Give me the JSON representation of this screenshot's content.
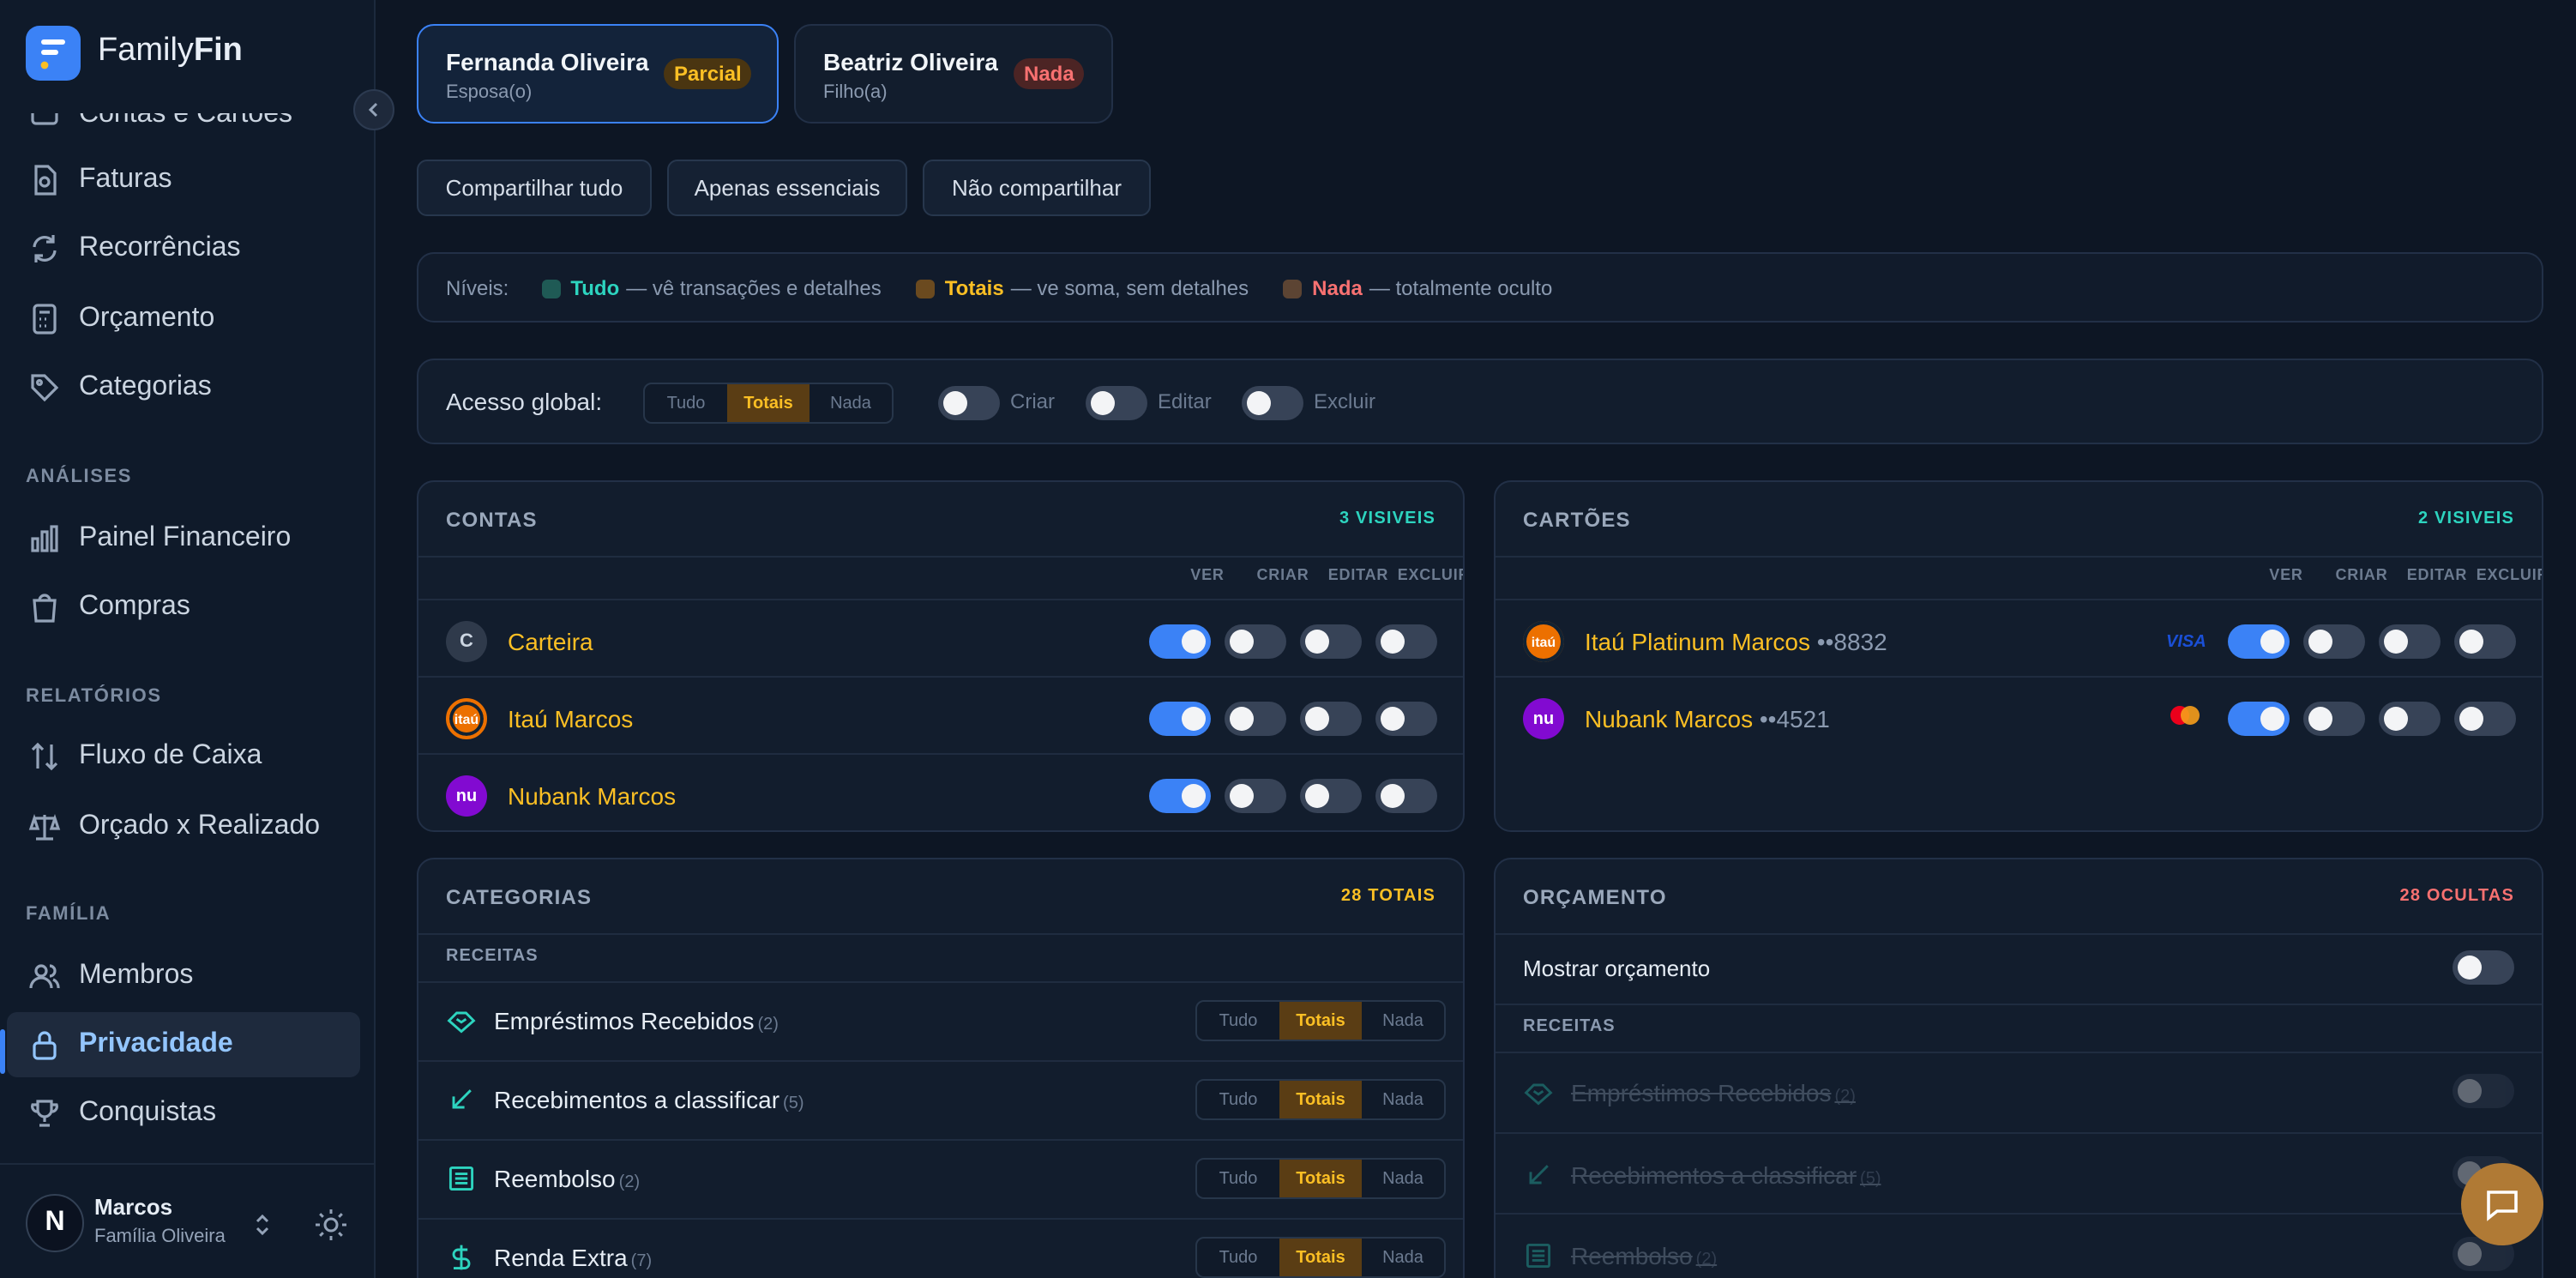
{
  "app": {
    "brand_prefix": "Family",
    "brand_suffix": "Fin"
  },
  "sidebar": {
    "partial_top_item": "Contas e Cartões",
    "items": [
      {
        "label": "Faturas",
        "icon": "invoice-icon"
      },
      {
        "label": "Recorrências",
        "icon": "refresh-icon"
      },
      {
        "label": "Orçamento",
        "icon": "calculator-icon"
      },
      {
        "label": "Categorias",
        "icon": "tag-icon"
      }
    ],
    "analises_title": "ANÁLISES",
    "analises": [
      {
        "label": "Painel Financeiro",
        "icon": "bar-chart-icon"
      },
      {
        "label": "Compras",
        "icon": "shopping-bag-icon"
      }
    ],
    "relatorios_title": "RELATÓRIOS",
    "relatorios": [
      {
        "label": "Fluxo de Caixa",
        "icon": "arrows-updown-icon"
      },
      {
        "label": "Orçado x Realizado",
        "icon": "scale-icon"
      }
    ],
    "familia_title": "FAMÍLIA",
    "familia": [
      {
        "label": "Membros",
        "icon": "users-icon"
      },
      {
        "label": "Privacidade",
        "icon": "lock-icon",
        "active": true
      },
      {
        "label": "Conquistas",
        "icon": "trophy-icon"
      }
    ],
    "user": {
      "initial": "N",
      "name": "Marcos",
      "family": "Família Oliveira"
    }
  },
  "members": [
    {
      "name": "Fernanda Oliveira",
      "role": "Esposa(o)",
      "badge": "Parcial",
      "selected": true
    },
    {
      "name": "Beatriz Oliveira",
      "role": "Filho(a)",
      "badge": "Nada",
      "selected": false
    }
  ],
  "presets": [
    "Compartilhar tudo",
    "Apenas essenciais",
    "Não compartilhar"
  ],
  "levels": {
    "label": "Níveis:",
    "tudo": "Tudo",
    "tudo_desc": "— vê transações e detalhes",
    "totais": "Totais",
    "totais_desc": "— ve soma, sem detalhes",
    "nada": "Nada",
    "nada_desc": "— totalmente oculto"
  },
  "global": {
    "label": "Acesso global:",
    "options": [
      "Tudo",
      "Totais",
      "Nada"
    ],
    "selected": "Totais",
    "criar": "Criar",
    "editar": "Editar",
    "excluir": "Excluir"
  },
  "columns": {
    "ver": "VER",
    "criar": "CRIAR",
    "editar": "EDITAR",
    "excluir": "EXCLUIR"
  },
  "contas": {
    "title": "CONTAS",
    "count": "3 VISIVEIS",
    "rows": [
      {
        "name": "Carteira",
        "icon_text": "C",
        "ver": true,
        "criar": false,
        "editar": false,
        "excluir": false
      },
      {
        "name": "Itaú Marcos",
        "icon_text": "itaú",
        "ver": true,
        "criar": false,
        "editar": false,
        "excluir": false
      },
      {
        "name": "Nubank Marcos",
        "icon_text": "nu",
        "ver": true,
        "criar": false,
        "editar": false,
        "excluir": false
      }
    ]
  },
  "cartoes": {
    "title": "CARTÕES",
    "count": "2 VISIVEIS",
    "rows": [
      {
        "name": "Itaú Platinum Marcos",
        "last4": "••8832",
        "brand": "VISA",
        "icon_text": "itaú",
        "ver": true,
        "criar": false,
        "editar": false,
        "excluir": false
      },
      {
        "name": "Nubank Marcos",
        "last4": "••4521",
        "brand": "mastercard",
        "icon_text": "nu",
        "ver": true,
        "criar": false,
        "editar": false,
        "excluir": false
      }
    ]
  },
  "categorias": {
    "title": "CATEGORIAS",
    "count": "28 TOTAIS",
    "group": "RECEITAS",
    "options": [
      "Tudo",
      "Totais",
      "Nada"
    ],
    "rows": [
      {
        "name": "Empréstimos Recebidos",
        "n": "(2)",
        "icon": "handshake-icon",
        "level": "Totais"
      },
      {
        "name": "Recebimentos a classificar",
        "n": "(5)",
        "icon": "arrow-down-left-icon",
        "level": "Totais"
      },
      {
        "name": "Reembolso",
        "n": "(2)",
        "icon": "receipt-icon",
        "level": "Totais"
      },
      {
        "name": "Renda Extra",
        "n": "(7)",
        "icon": "dollar-icon",
        "level": "Totais"
      }
    ]
  },
  "orcamento": {
    "title": "ORÇAMENTO",
    "count": "28 OCULTAS",
    "show_label": "Mostrar orçamento",
    "group": "RECEITAS",
    "rows": [
      {
        "name": "Empréstimos Recebidos",
        "n": "(2)"
      },
      {
        "name": "Recebimentos a classificar",
        "n": "(5)"
      },
      {
        "name": "Reembolso",
        "n": "(2)"
      }
    ]
  },
  "colors": {
    "accent": "#3b82f6",
    "tudo": "#2dd4bf",
    "totais": "#fbbf24",
    "nada": "#f87171",
    "bg": "#0d1624"
  }
}
